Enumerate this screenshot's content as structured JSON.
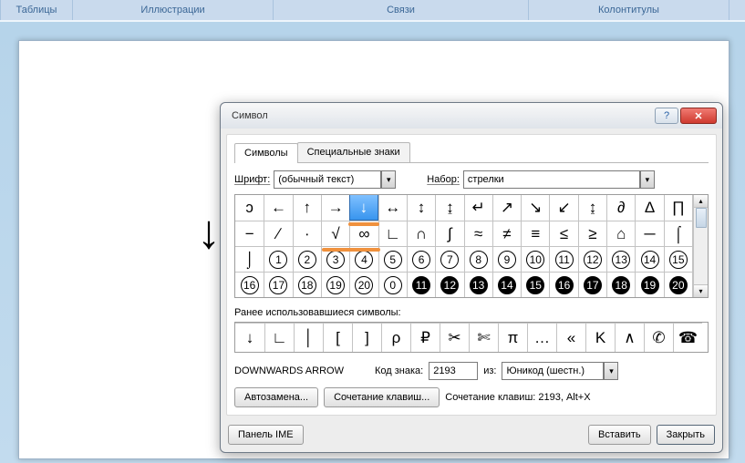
{
  "ribbon": {
    "groups": [
      "Таблицы",
      "Иллюстрации",
      "Связи",
      "Колонтитулы"
    ]
  },
  "document_sample": "↓",
  "dialog": {
    "title": "Символ",
    "tabs": {
      "symbols": "Символы",
      "special": "Специальные знаки"
    },
    "font": {
      "label": "Шрифт:",
      "value": "(обычный текст)"
    },
    "subset": {
      "label": "Набор:",
      "value": "стрелки"
    },
    "grid": [
      "ɔ",
      "←",
      "↑",
      "→",
      "↓",
      "↔",
      "↕",
      "↨",
      "↵",
      "↗",
      "↘",
      "↙",
      "↨",
      "∂",
      "Δ",
      "∏",
      "−",
      "∕",
      "∙",
      "√",
      "∞",
      "∟",
      "∩",
      "∫",
      "≈",
      "≠",
      "≡",
      "≤",
      "≥",
      "⌂",
      "─",
      "⌠",
      "⌡",
      "①",
      "②",
      "③",
      "④",
      "⑤",
      "⑥",
      "⑦",
      "⑧",
      "⑨",
      "⑩",
      "⑪",
      "⑫",
      "⑬",
      "⑭",
      "⑮",
      "⑯",
      "⑰",
      "⑱",
      "⑲",
      "⑳",
      "⓪",
      "⓫",
      "⓬",
      "⓭",
      "⓮",
      "⓯",
      "⓰",
      "⓱",
      "⓲",
      "⓳",
      "⓴"
    ],
    "selected_index": 4,
    "recent_label": "Ранее использовавшиеся символы:",
    "recent": [
      "↓",
      "∟",
      "│",
      "[",
      "]",
      "ρ",
      "₽",
      "✂",
      "✄",
      "π",
      "…",
      "«",
      "K",
      "∧",
      "✆",
      "☎"
    ],
    "info": {
      "name": "DOWNWARDS ARROW",
      "code_label": "Код знака:",
      "code": "2193",
      "from_label": "из:",
      "from": "Юникод (шестн.)"
    },
    "autocorrect": "Автозамена...",
    "shortcut_btn": "Сочетание клавиш...",
    "shortcut_text": "Сочетание клавиш: 2193, Alt+X",
    "ime": "Панель IME",
    "insert": "Вставить",
    "close": "Закрыть"
  }
}
